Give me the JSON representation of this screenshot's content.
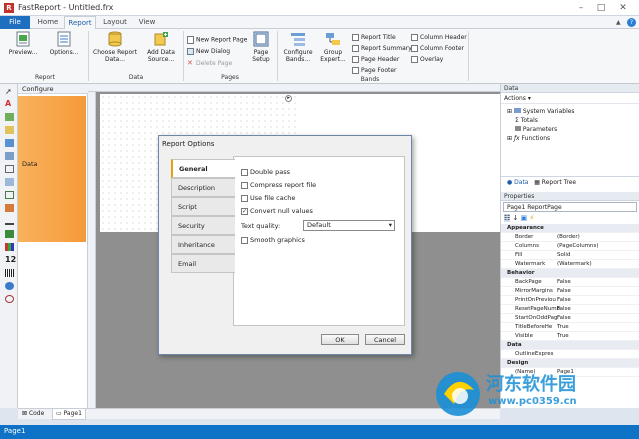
{
  "window": {
    "title": "FastReport - Untitled.frx"
  },
  "tabs": [
    "File",
    "Home",
    "Report",
    "Layout",
    "View"
  ],
  "ribbon": {
    "report_group": {
      "label": "Report",
      "buttons": [
        "Preview...",
        "Options..."
      ]
    },
    "data_group": {
      "label": "Data",
      "buttons": [
        "Choose Report Data...",
        "Add Data Source..."
      ]
    },
    "pages_group": {
      "label": "Pages",
      "new_report_page": "New Report Page",
      "new_dialog": "New Dialog",
      "delete_page": "Delete Page",
      "page_setup": "Page Setup"
    },
    "bands_group": {
      "label": "Bands",
      "configure_bands": "Configure Bands...",
      "group_expert": "Group Expert...",
      "checks_col1": [
        "Report Title",
        "Report Summary",
        "Page Header",
        "Page Footer"
      ],
      "checks_col2": [
        "Column Header",
        "Column Footer",
        "Overlay"
      ]
    }
  },
  "band_panel": {
    "configure": "Configure",
    "data_band": "Data"
  },
  "data_panel": {
    "title": "Data",
    "actions": "Actions",
    "tree": [
      "System Variables",
      "Totals",
      "Parameters",
      "Functions"
    ],
    "tabs": [
      "Data",
      "Report Tree"
    ]
  },
  "properties": {
    "title": "Properties",
    "object": "Page1 ReportPage",
    "rows": [
      {
        "cat": true,
        "name": "Appearance",
        "value": ""
      },
      {
        "name": "Border",
        "value": "(Border)"
      },
      {
        "name": "Columns",
        "value": "(PageColumns)"
      },
      {
        "name": "Fill",
        "value": "Solid"
      },
      {
        "name": "Watermark",
        "value": "(Watermark)"
      },
      {
        "cat": true,
        "name": "Behavior",
        "value": ""
      },
      {
        "name": "BackPage",
        "value": "False"
      },
      {
        "name": "MirrorMargins",
        "value": "False"
      },
      {
        "name": "PrintOnPreviou",
        "value": "False"
      },
      {
        "name": "ResetPageNumb",
        "value": "False"
      },
      {
        "name": "StartOnOddPag",
        "value": "False"
      },
      {
        "name": "TitleBeforeHe",
        "value": "True"
      },
      {
        "name": "Visible",
        "value": "True"
      },
      {
        "cat": true,
        "name": "Data",
        "value": ""
      },
      {
        "name": "OutlineExpres",
        "value": ""
      },
      {
        "cat": true,
        "name": "Design",
        "value": ""
      },
      {
        "name": "(Name)",
        "value": "Page1"
      }
    ]
  },
  "bottom_tabs": [
    "Code",
    "Page1"
  ],
  "status": {
    "text": "Page1"
  },
  "dialog": {
    "title": "Report Options",
    "tabs": [
      "General",
      "Description",
      "Script",
      "Security",
      "Inheritance",
      "Email"
    ],
    "options": [
      {
        "label": "Double pass",
        "checked": false
      },
      {
        "label": "Compress report file",
        "checked": false
      },
      {
        "label": "Use file cache",
        "checked": false
      },
      {
        "label": "Convert null values",
        "checked": true
      }
    ],
    "text_quality_label": "Text quality:",
    "text_quality_value": "Default",
    "smooth_graphics": {
      "label": "Smooth graphics",
      "checked": false
    },
    "ok": "OK",
    "cancel": "Cancel"
  },
  "watermark": {
    "line1": "河东软件园",
    "line2": "www.pc0359.cn"
  },
  "colors": {
    "accent": "#0e73c6",
    "band": "#f7a64a",
    "dialog_tab_accent": "#e3a21a"
  }
}
